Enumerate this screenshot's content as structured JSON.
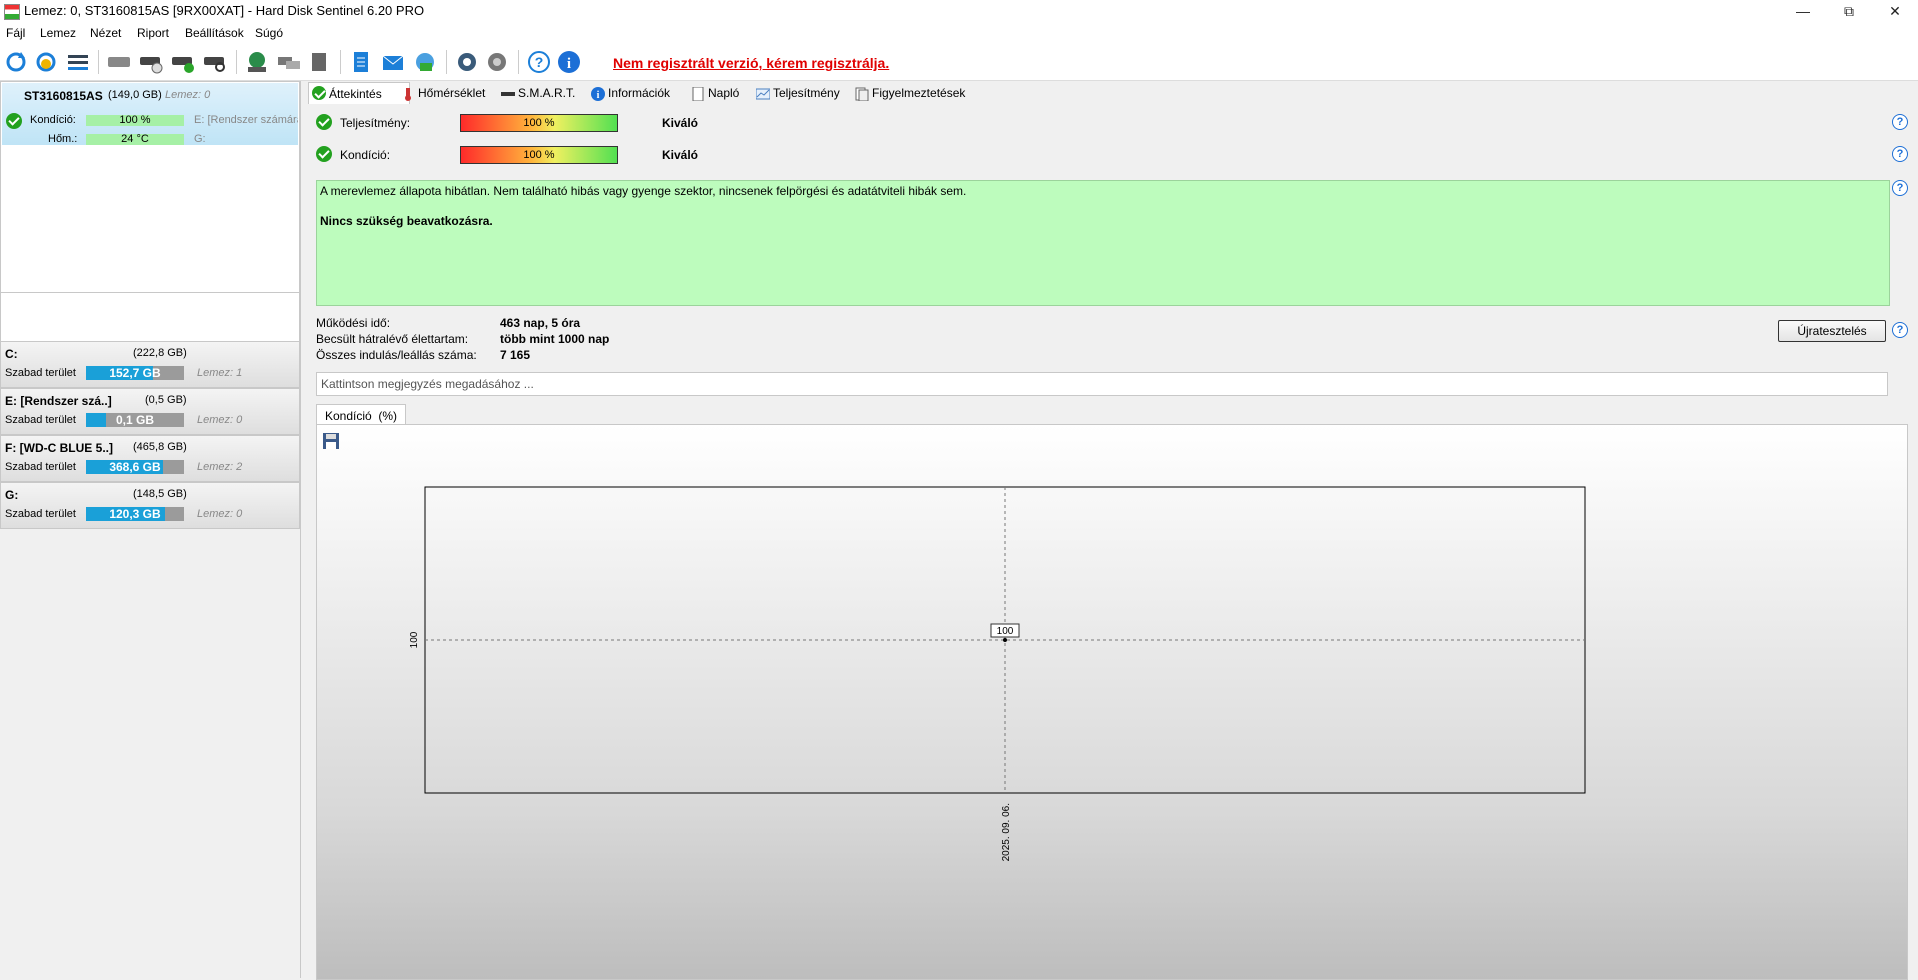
{
  "window": {
    "title": "Lemez: 0, ST3160815AS [9RX00XAT]  -  Hard Disk Sentinel 6.20 PRO"
  },
  "menu": [
    "Fájl",
    "Lemez",
    "Nézet",
    "Riport",
    "Beállítások",
    "Súgó"
  ],
  "toolbar": {
    "unregistered_text": "Nem regisztrált verzió, kérem regisztrálja."
  },
  "disk": {
    "name": "ST3160815AS",
    "size": "(149,0 GB)",
    "index_label": "Lemez: 0",
    "health_label": "Kondíció:",
    "health_value": "100 %",
    "health_percent": 100,
    "temp_label": "Hőm.:",
    "temp_value": "24 °C",
    "partition1": "E: [Rendszer számára",
    "partition2": "G:"
  },
  "volumes": [
    {
      "letter": "C:",
      "size": "(222,8 GB)",
      "free_label": "Szabad terület",
      "free": "152,7 GB",
      "fill": 0.68,
      "disk": "Lemez: 1"
    },
    {
      "letter": "E: [Rendszer szá..]",
      "size": "(0,5 GB)",
      "free_label": "Szabad terület",
      "free": "0,1 GB",
      "fill": 0.2,
      "disk": "Lemez: 0"
    },
    {
      "letter": "F: [WD-C BLUE 5..]",
      "size": "(465,8 GB)",
      "free_label": "Szabad terület",
      "free": "368,6 GB",
      "fill": 0.79,
      "disk": "Lemez: 2"
    },
    {
      "letter": "G:",
      "size": "(148,5 GB)",
      "free_label": "Szabad terület",
      "free": "120,3 GB",
      "fill": 0.81,
      "disk": "Lemez: 0"
    }
  ],
  "tabs": [
    "Áttekintés",
    "Hőmérséklet",
    "S.M.A.R.T.",
    "Információk",
    "Napló",
    "Teljesítmény",
    "Figyelmeztetések"
  ],
  "overview": {
    "performance_label": "Teljesítmény:",
    "performance_value": "100 %",
    "performance_percent": 100,
    "performance_rating": "Kiváló",
    "health_label": "Kondíció:",
    "health_value": "100 %",
    "health_percent": 100,
    "health_rating": "Kiváló",
    "status_text": "A merevlemez állapota hibátlan. Nem található hibás vagy gyenge szektor, nincsenek felpörgési és adatátviteli hibák sem.",
    "status_action": "Nincs szükség beavatkozásra.",
    "power_on_label": "Működési idő:",
    "power_on_value": "463 nap, 5 óra",
    "remaining_label": "Becsült hátralévő élettartam:",
    "remaining_value": "több mint 1000 nap",
    "startstop_label": "Összes indulás/leállás száma:",
    "startstop_value": "7 165",
    "retest_button": "Újratesztelés",
    "notes_placeholder": "Kattintson megjegyzés megadásához ..."
  },
  "chart_tab": "Kondíció  (%)",
  "chart_data": {
    "type": "line",
    "x": [
      "2025. 09. 06."
    ],
    "series": [
      {
        "values": [
          100
        ]
      }
    ],
    "point_labels": [
      "100"
    ],
    "y_tick_labels": [
      "100"
    ],
    "x_tick_labels": [
      "2025. 09. 06."
    ],
    "grid": true
  }
}
